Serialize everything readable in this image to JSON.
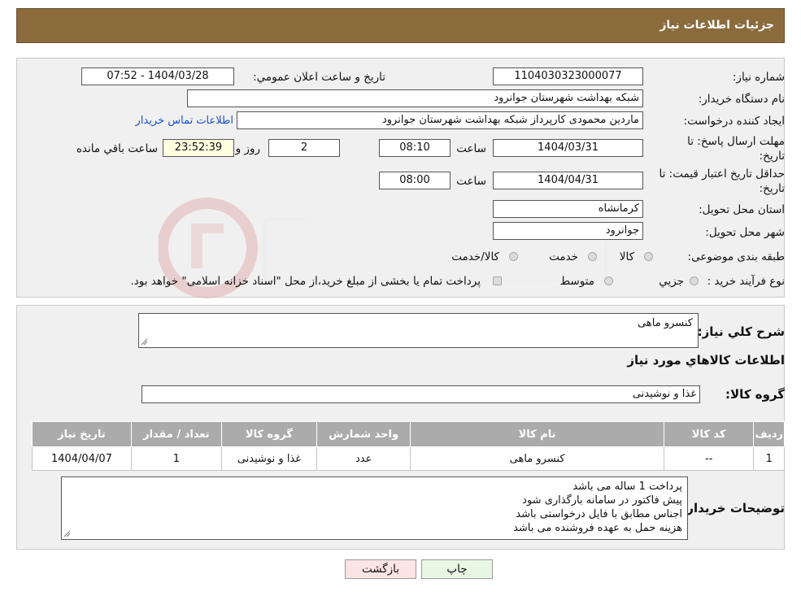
{
  "header": {
    "title": "جزئيات اطلاعات نياز"
  },
  "form": {
    "need_number_label": "شماره نياز:",
    "need_number": "1104030323000077",
    "announce_label": "تاريخ و ساعت اعلان عمومي:",
    "announce_value": "1404/03/28 - 07:52",
    "buyer_org_label": "نام دستگاه خريدار:",
    "buyer_org": "شبکه بهداشت شهرستان جوانرود",
    "creator_label": "ايجاد کننده درخواست:",
    "creator": "ماردين محمودی کارپرداز شبکه بهداشت شهرستان جوانرود",
    "contact_link": "اطلاعات تماس خريدار",
    "deadline_label_1": "مهلت ارسال پاسخ: تا",
    "deadline_label_2": "تاريخ:",
    "deadline_date": "1404/03/31",
    "time_label": "ساعت",
    "deadline_time": "08:10",
    "days": "2",
    "days_label": "روز و",
    "remaining_time": "23:52:39",
    "remaining_label": "ساعت باقي مانده",
    "validity_label_1": "حداقل تاريخ اعتبار قيمت: تا",
    "validity_label_2": "تاريخ:",
    "validity_date": "1404/04/31",
    "validity_time": "08:00",
    "province_label": "استان محل تحويل:",
    "province": "کرمانشاه",
    "city_label": "شهر محل تحويل:",
    "city": "جوانرود",
    "category_label": "طبقه بندی موضوعی:",
    "category_options": [
      "کالا",
      "خدمت",
      "کالا/خدمت"
    ],
    "process_label": "نوع فرآيند خريد :",
    "process_options": [
      "جزيي",
      "متوسط"
    ],
    "process_note": "پرداخت تمام يا بخشی از مبلغ خريد،از محل \"اسناد خزانه اسلامی\" خواهد بود."
  },
  "details": {
    "summary_label": "شرح کلي نياز:",
    "summary_value": "کنسرو ماهی",
    "goods_info_title": "اطلاعات کالاهاي مورد نياز",
    "group_label": "گروه کالا:",
    "group_value": "غذا و نوشيدنی",
    "table": {
      "headers": [
        "رديف",
        "کد کالا",
        "نام کالا",
        "واحد شمارش",
        "گروه کالا",
        "تعداد / مقدار",
        "تاريخ نياز"
      ],
      "rows": [
        [
          "1",
          "--",
          "کنسرو ماهی",
          "عدد",
          "غذا و نوشيدنی",
          "1",
          "1404/04/07"
        ]
      ]
    },
    "buyer_notes_label": "توضيحات خريدار:",
    "buyer_notes": [
      "پرداخت 1 ساله می باشد",
      "پيش فاکتور در سامانه بارگذاری شود",
      "اجناس مطابق با فايل درخواستی باشد",
      "هزينه حمل به عهده فروشنده می باشد"
    ]
  },
  "buttons": {
    "print": "چاپ",
    "back": "بازگشت"
  },
  "colors": {
    "header_bg": "#8b6a3c",
    "table_header_bg": "#ababab",
    "back_button_bg": "#fde4e4",
    "print_button_bg": "#e8f7e4"
  }
}
